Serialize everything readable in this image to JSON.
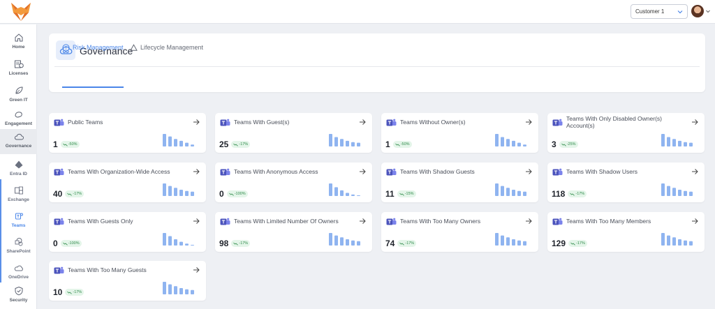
{
  "header": {
    "customer_select": "Customer 1"
  },
  "sidebar": {
    "items": [
      {
        "key": "home",
        "label": "Home",
        "icon": "home-icon"
      },
      {
        "key": "licenses",
        "label": "Licenses",
        "icon": "license-icon"
      },
      {
        "key": "green-it",
        "label": "Green IT",
        "icon": "leaf-icon"
      },
      {
        "key": "engagement",
        "label": "Engagement",
        "icon": "engagement-icon"
      },
      {
        "key": "governance",
        "label": "Governance",
        "icon": "cloud-icon"
      },
      {
        "key": "entra-id",
        "label": "Entra ID",
        "icon": "entra-icon"
      },
      {
        "key": "exchange",
        "label": "Exchange",
        "icon": "exchange-icon"
      },
      {
        "key": "teams",
        "label": "Teams",
        "icon": "teams-icon"
      },
      {
        "key": "sharepoint",
        "label": "SharePoint",
        "icon": "sharepoint-icon"
      },
      {
        "key": "onedrive",
        "label": "OneDrive",
        "icon": "onedrive-icon"
      },
      {
        "key": "security",
        "label": "Security",
        "icon": "shield-icon"
      }
    ]
  },
  "page": {
    "title": "Governance",
    "tabs": [
      {
        "label": "Risk Management",
        "icon": "alert-circle-icon",
        "active": true
      },
      {
        "label": "Lifecycle Management",
        "icon": "recycle-icon",
        "active": false
      }
    ]
  },
  "cards": [
    {
      "title": "Public Teams",
      "value": "1",
      "change": "-50%",
      "spark": [
        1.0,
        0.8,
        0.6,
        0.45,
        0.3,
        0.15
      ]
    },
    {
      "title": "Teams With Guest(s)",
      "value": "25",
      "change": "-17%",
      "spark": [
        1.0,
        0.75,
        0.6,
        0.45,
        0.35,
        0.3
      ]
    },
    {
      "title": "Teams Without Owner(s)",
      "value": "1",
      "change": "-50%",
      "spark": [
        1.0,
        0.75,
        0.6,
        0.45,
        0.3,
        0.15
      ]
    },
    {
      "title": "Teams With Only Disabled Owner(s) Account(s)",
      "value": "3",
      "change": "-25%",
      "spark": [
        1.0,
        0.75,
        0.6,
        0.45,
        0.35,
        0.3
      ]
    },
    {
      "title": "Teams With Organization-Wide Access",
      "value": "40",
      "change": "-17%",
      "spark": [
        1.0,
        0.8,
        0.65,
        0.5,
        0.4,
        0.35
      ]
    },
    {
      "title": "Teams With Anonymous Access",
      "value": "0",
      "change": "-100%",
      "spark": [
        1.0,
        0.7,
        0.45,
        0.25,
        0.12,
        0.05
      ]
    },
    {
      "title": "Teams With Shadow Guests",
      "value": "11",
      "change": "-15%",
      "spark": [
        1.0,
        0.8,
        0.65,
        0.5,
        0.4,
        0.35
      ]
    },
    {
      "title": "Teams With Shadow Users",
      "value": "118",
      "change": "-17%",
      "spark": [
        1.0,
        0.8,
        0.65,
        0.5,
        0.4,
        0.35
      ]
    },
    {
      "title": "Teams With Guests Only",
      "value": "0",
      "change": "-100%",
      "spark": [
        1.0,
        0.75,
        0.5,
        0.3,
        0.15,
        0.05
      ]
    },
    {
      "title": "Teams With Limited Number Of Owners",
      "value": "98",
      "change": "-17%",
      "spark": [
        1.0,
        0.8,
        0.65,
        0.5,
        0.4,
        0.35
      ]
    },
    {
      "title": "Teams With Too Many Owners",
      "value": "74",
      "change": "-17%",
      "spark": [
        1.0,
        0.8,
        0.65,
        0.5,
        0.4,
        0.35
      ]
    },
    {
      "title": "Teams With Too Many Members",
      "value": "129",
      "change": "-17%",
      "spark": [
        1.0,
        0.8,
        0.65,
        0.5,
        0.4,
        0.35
      ]
    },
    {
      "title": "Teams With Too Many Guests",
      "value": "10",
      "change": "-17%",
      "spark": [
        1.0,
        0.8,
        0.65,
        0.5,
        0.4,
        0.35
      ]
    }
  ],
  "colors": {
    "accent": "#4a86e8",
    "spark": "#8fb4f0",
    "badge_bg": "#e4f5e9",
    "badge_text": "#2f8a4a"
  }
}
